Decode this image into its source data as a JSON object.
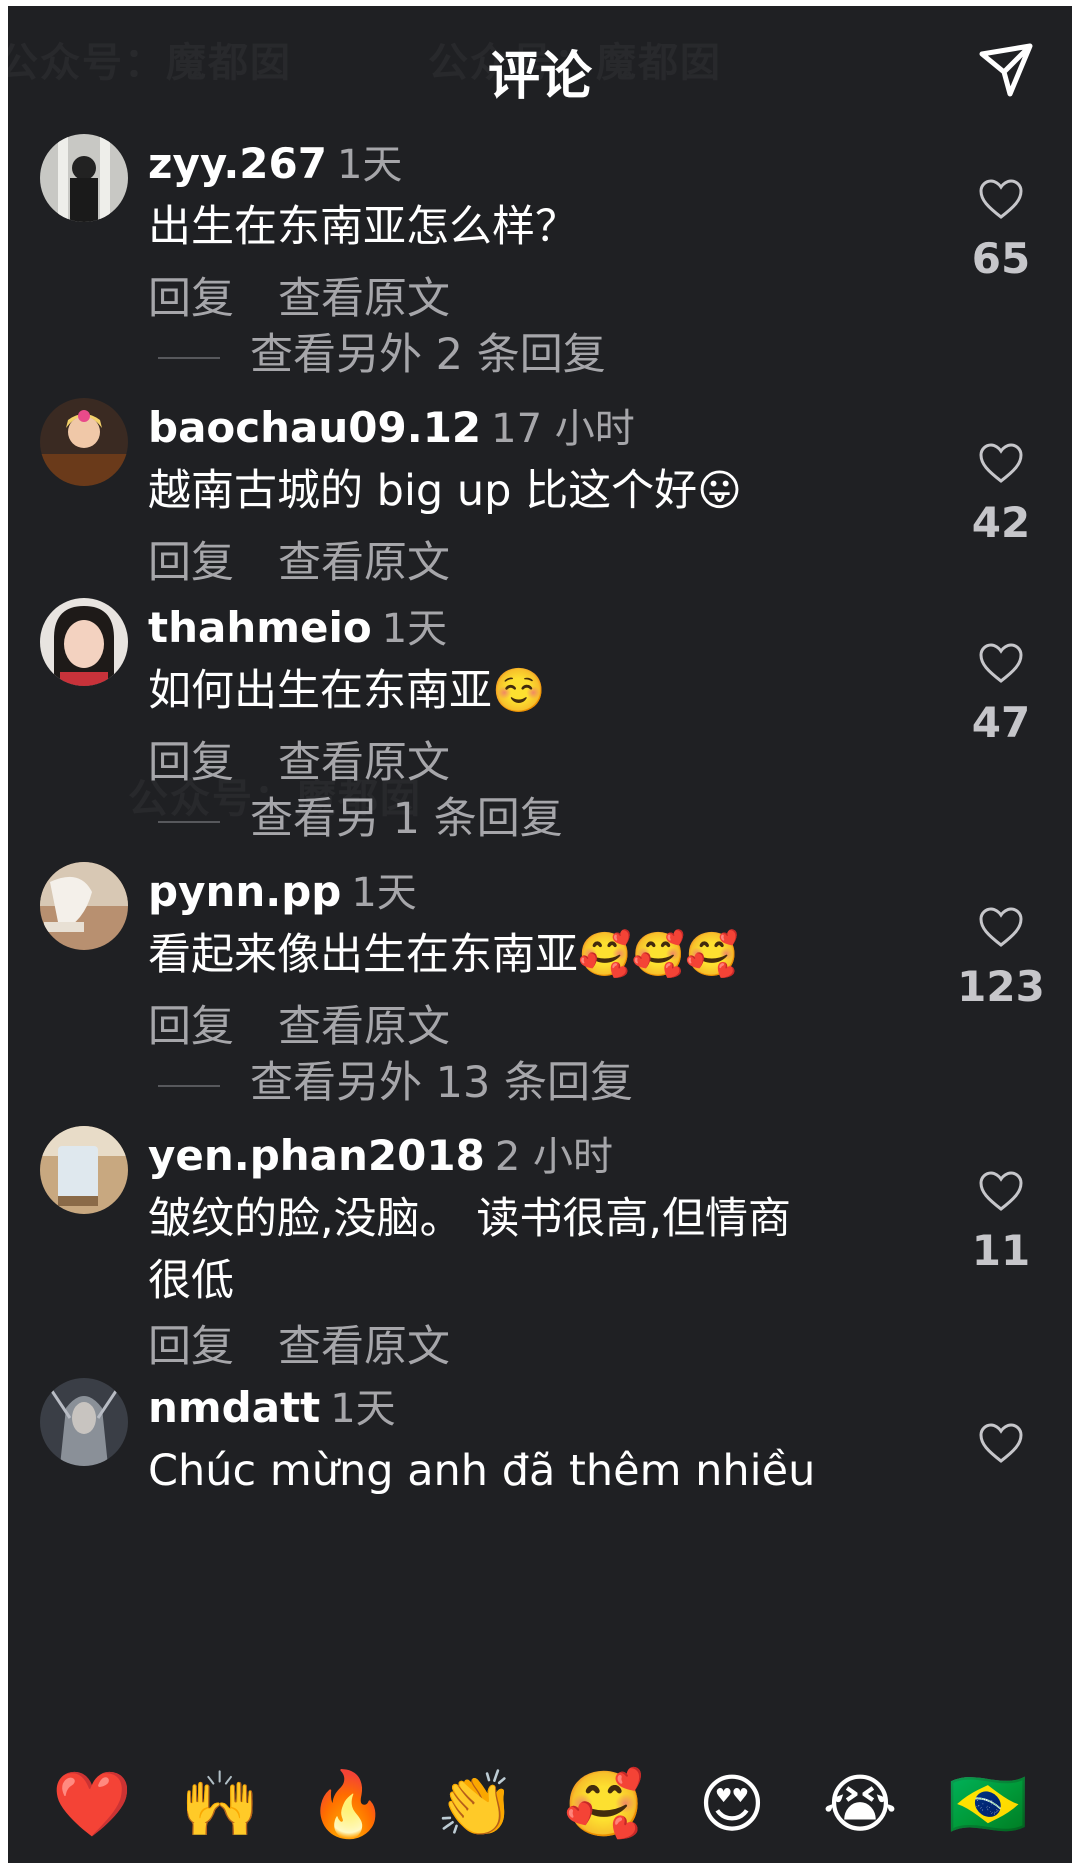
{
  "header": {
    "title": "评论",
    "send_icon": "send-icon"
  },
  "watermark": [
    "公众号：魔都囡",
    "公众号：魔都囡",
    "公众号：魔都囡"
  ],
  "comments": [
    {
      "username": "zyy.267",
      "time": "1天",
      "text": "出生在东南亚怎么样？",
      "reply_label": "回复",
      "view_original_label": "查看原文",
      "more_replies": "查看另外 2 条回复",
      "likes": "65"
    },
    {
      "username": "baochau09.12",
      "time": "17 小时",
      "text": "越南古城的 big up 比这个好😛",
      "reply_label": "回复",
      "view_original_label": "查看原文",
      "likes": "42"
    },
    {
      "username": "thahmeio",
      "time": "1天",
      "text": "如何出生在东南亚☺️",
      "reply_label": "回复",
      "view_original_label": "查看原文",
      "more_replies": "查看另 1 条回复",
      "likes": "47"
    },
    {
      "username": "pynn.pp",
      "time": "1天",
      "text": "看起来像出生在东南亚🥰🥰🥰",
      "reply_label": "回复",
      "view_original_label": "查看原文",
      "more_replies": "查看另外 13 条回复",
      "likes": "123"
    },
    {
      "username": "yen.phan2018",
      "time": "2 小时",
      "text": "皱纹的脸,没脑。 读书很高,但情商很低",
      "reply_label": "回复",
      "view_original_label": "查看原文",
      "likes": "11"
    },
    {
      "username": "nmdatt",
      "time": "1天",
      "text": "Chúc mừng anh đã thêm nhiều"
    }
  ],
  "emoji_bar": [
    "❤️",
    "🙌",
    "🔥",
    "👏",
    "🥰",
    "😍",
    "😭",
    "🇧🇷"
  ],
  "colors": {
    "background": "#1f2023",
    "text": "#ffffff",
    "secondary_text": "#a6a6aa"
  }
}
